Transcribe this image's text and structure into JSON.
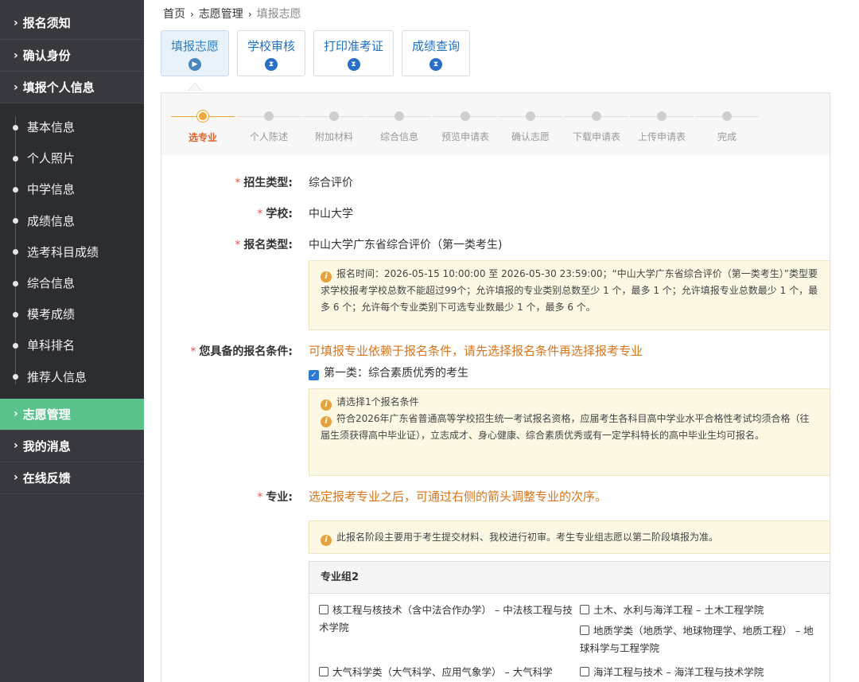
{
  "sidebar": {
    "top_items": [
      {
        "label": "报名须知"
      },
      {
        "label": "确认身份"
      },
      {
        "label": "填报个人信息"
      }
    ],
    "sub_items": [
      {
        "label": "基本信息"
      },
      {
        "label": "个人照片"
      },
      {
        "label": "中学信息"
      },
      {
        "label": "成绩信息"
      },
      {
        "label": "选考科目成绩"
      },
      {
        "label": "综合信息"
      },
      {
        "label": "模考成绩"
      },
      {
        "label": "单科排名"
      },
      {
        "label": "推荐人信息"
      }
    ],
    "bottom_items": [
      {
        "label": "志愿管理",
        "active": true
      },
      {
        "label": "我的消息"
      },
      {
        "label": "在线反馈"
      }
    ],
    "chevron": "›",
    "active_color": "#5cc28d"
  },
  "breadcrumb": {
    "home": "首页",
    "section": "志愿管理",
    "current": "填报志愿",
    "sep": "›"
  },
  "stage_tabs": [
    {
      "label": "填报志愿",
      "icon": "play-icon",
      "glyph": "▶",
      "active": true
    },
    {
      "label": "学校审核",
      "icon": "hourglass-icon",
      "glyph": "⧗"
    },
    {
      "label": "打印准考证",
      "icon": "hourglass-icon",
      "glyph": "⧗"
    },
    {
      "label": "成绩查询",
      "icon": "hourglass-icon",
      "glyph": "⧗"
    }
  ],
  "steps": [
    {
      "label": "选专业",
      "active": true
    },
    {
      "label": "个人陈述"
    },
    {
      "label": "附加材料"
    },
    {
      "label": "综合信息"
    },
    {
      "label": "预览申请表"
    },
    {
      "label": "确认志愿"
    },
    {
      "label": "下载申请表"
    },
    {
      "label": "上传申请表"
    },
    {
      "label": "完成"
    }
  ],
  "form": {
    "required_mark": "*",
    "enroll_type": {
      "label": "招生类型:",
      "value": "综合评价"
    },
    "school": {
      "label": "学校:",
      "value": "中山大学"
    },
    "apply_type": {
      "label": "报名类型:",
      "value": "中山大学广东省综合评价（第一类考生)"
    },
    "apply_note": "报名时间：2026-05-15 10:00:00 至 2026-05-30 23:59:00；“中山大学广东省综合评价（第一类考生）”类型要求学校报考学校总数不能超过99个；允许填报的专业类别总数至少 1 个，最多 1 个；允许填报专业总数最少 1 个，最多 6 个；允许每个专业类别下可选专业数最少 1 个，最多 6 个。",
    "conditions": {
      "label": "您具备的报名条件:",
      "hint": "可填报专业依赖于报名条件，请先选择报名条件再选择报考专业",
      "option": "第一类：综合素质优秀的考生",
      "option_checked": true,
      "note_line1": "请选择1个报名条件",
      "note_line2": "符合2026年广东省普通高等学校招生统一考试报名资格，应届考生各科目高中学业水平合格性考试均须合格（往届生须获得高中毕业证），立志成才、身心健康、综合素质优秀或有一定学科特长的高中毕业生均可报名。"
    },
    "major": {
      "label": "专业:",
      "hint": "选定报考专业之后，可通过右侧的箭头调整专业的次序。",
      "note": "此报名阶段主要用于考生提交材料、我校进行初审。考生专业组志愿以第二阶段填报为准。",
      "group_title": "专业组2",
      "options": [
        {
          "text": "核工程与核技术（含中法合作办学） – 中法核工程与技术学院"
        },
        {
          "text": "土木、水利与海洋工程 – 土木工程学院"
        },
        {
          "text": "地质学类（地质学、地球物理学、地质工程） – 地球科学与工程学院"
        },
        {
          "text": "大气科学类（大气科学、应用气象学） – 大气科学"
        },
        {
          "text": "海洋工程与技术 – 海洋工程与技术学院"
        }
      ]
    }
  },
  "info_glyph": "i",
  "check_glyph": "✓"
}
